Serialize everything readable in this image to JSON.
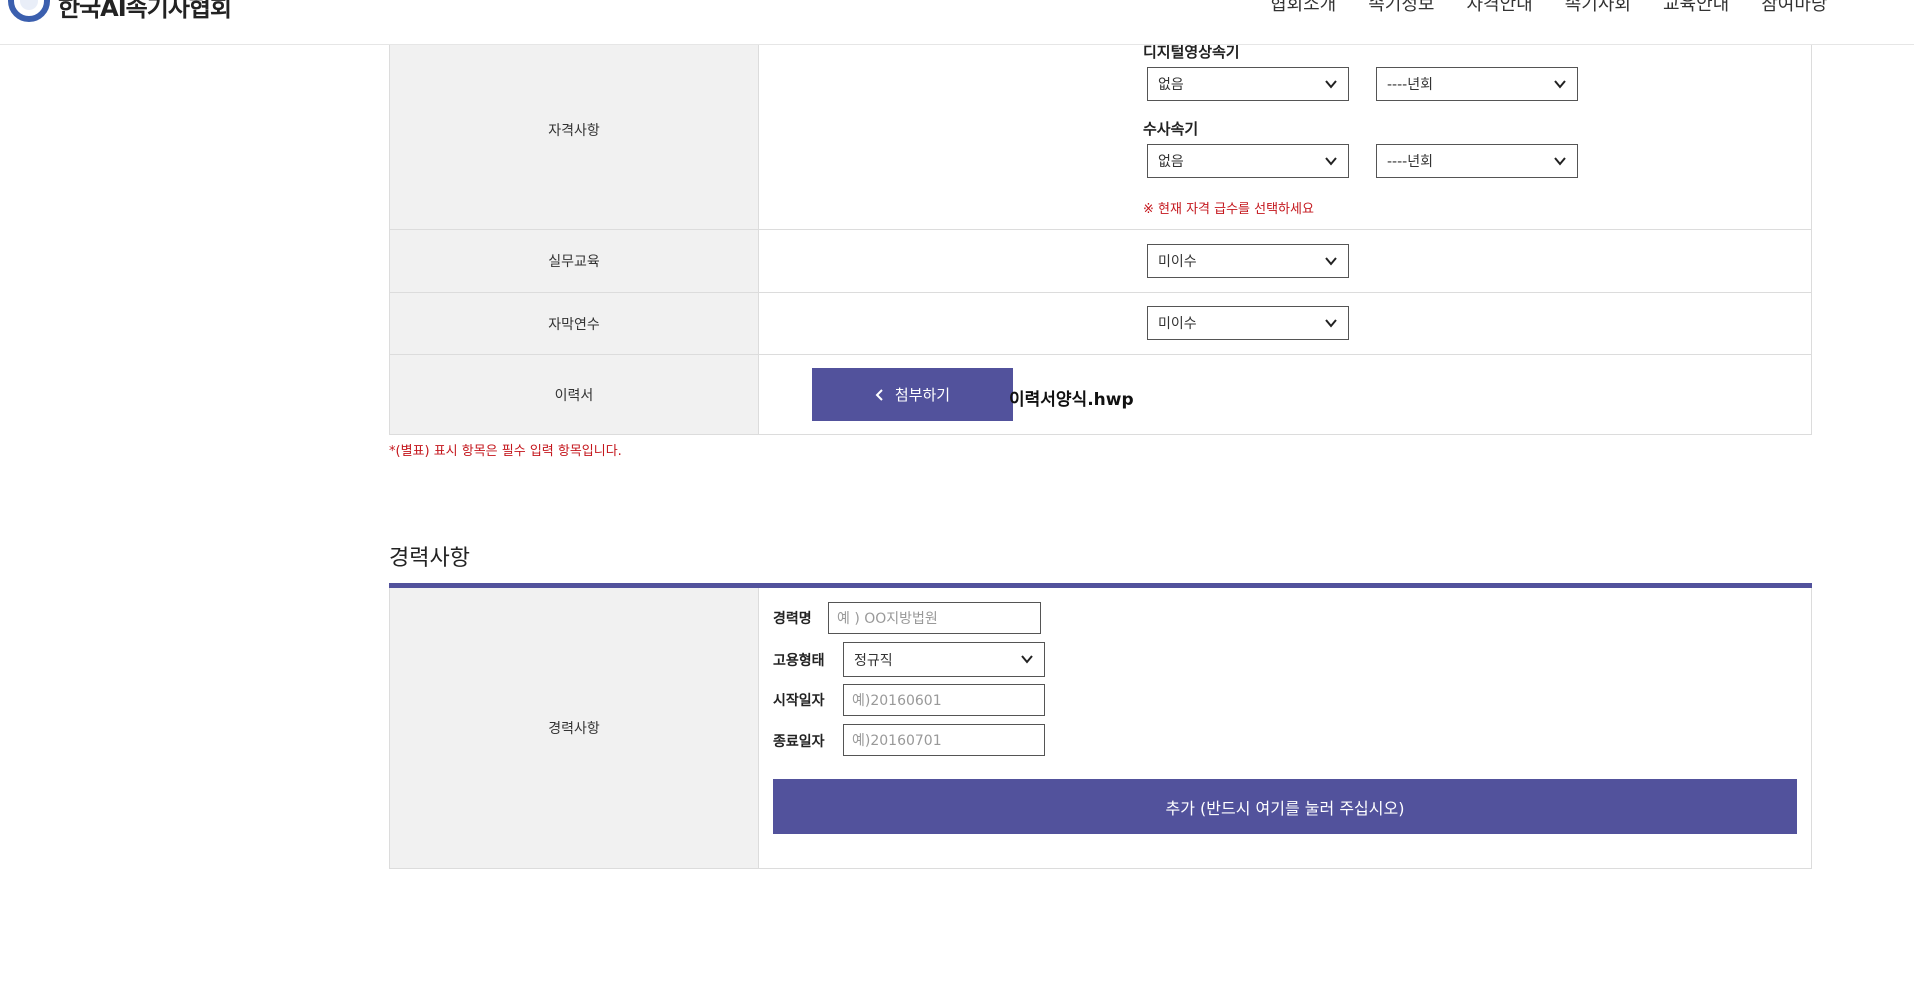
{
  "header": {
    "logo_text": "한국AI속기사협회",
    "nav": [
      "협회소개",
      "속기정보",
      "자격안내",
      "속기사회",
      "교육안내",
      "참여마당"
    ]
  },
  "qualification": {
    "label": "자격사항",
    "digital_label": "디지털영상속기",
    "digital_grade": "없음",
    "digital_round": "----년회",
    "investigation_label": "수사속기",
    "investigation_grade": "없음",
    "investigation_round": "----년회",
    "note": "※ 현재 자격 급수를 선택하세요"
  },
  "practical_education": {
    "label": "실무교육",
    "value": "미이수"
  },
  "caption_training": {
    "label": "자막연수",
    "value": "미이수"
  },
  "resume": {
    "label": "이력서",
    "attach_label": "첨부하기",
    "filename": "이력서양식.hwp"
  },
  "required_note": "*(별표) 표시 항목은 필수 입력 항목입니다.",
  "career": {
    "section_title": "경력사항",
    "row_label": "경력사항",
    "company_label": "경력명",
    "company_placeholder": "예 ) OO지방법원",
    "employment_label": "고용형태",
    "employment_value": "정규직",
    "start_label": "시작일자",
    "start_placeholder": "예)20160601",
    "end_label": "종료일자",
    "end_placeholder": "예)20160701",
    "add_button": "추가 (반드시 여기를 눌러 주십시오)"
  }
}
